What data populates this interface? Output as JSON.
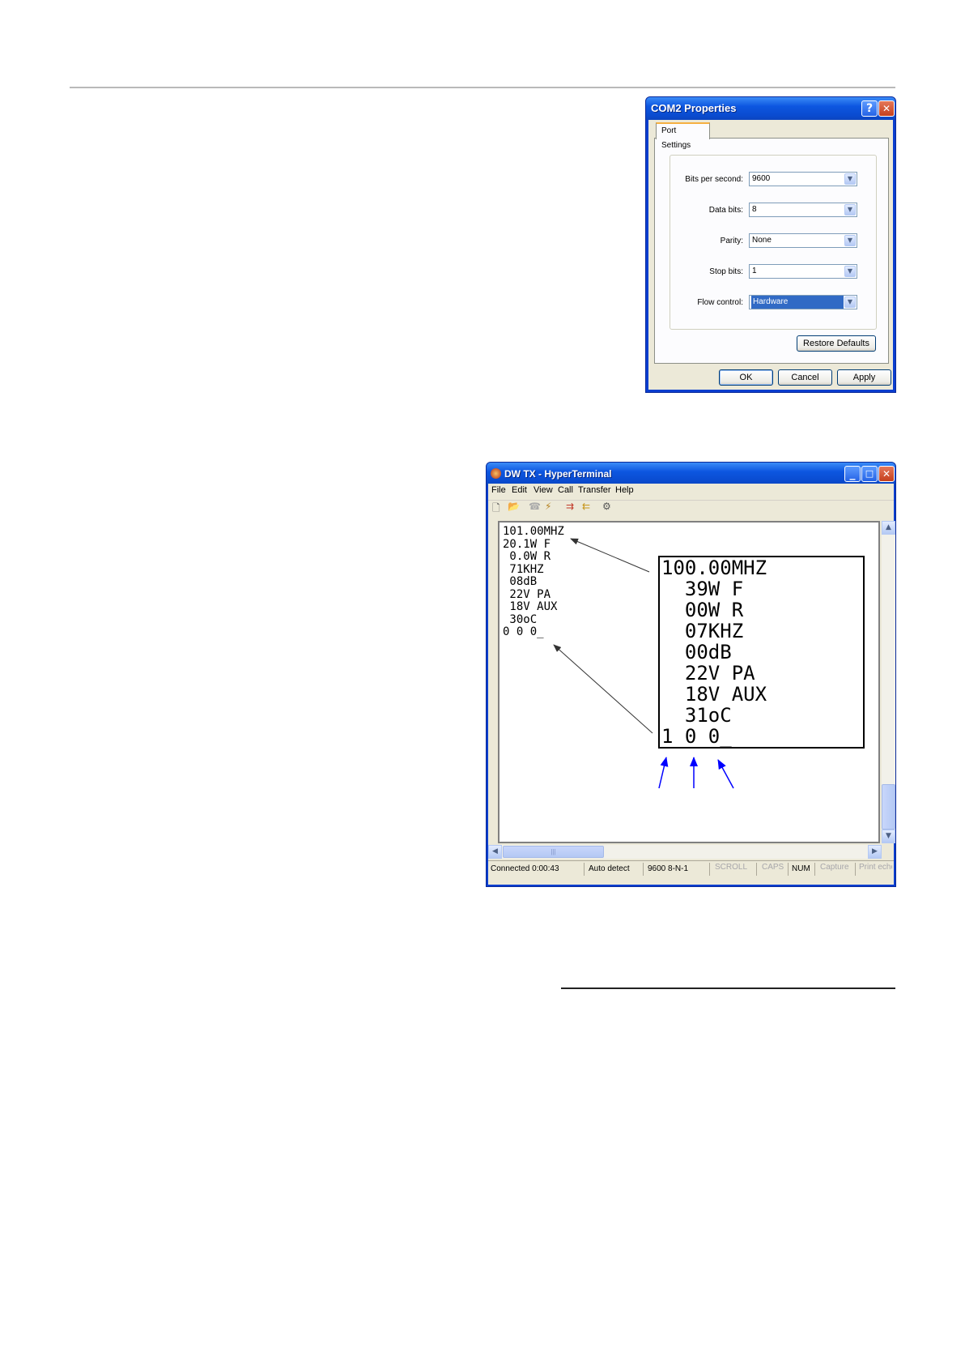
{
  "com_dialog": {
    "title": "COM2 Properties",
    "help_button": "?",
    "close_button": "✕",
    "tab": "Port Settings",
    "fields": [
      {
        "label": "Bits per second:",
        "value": "9600"
      },
      {
        "label": "Data bits:",
        "value": "8"
      },
      {
        "label": "Parity:",
        "value": "None"
      },
      {
        "label": "Stop bits:",
        "value": "1"
      },
      {
        "label": "Flow control:",
        "value": "Hardware"
      }
    ],
    "restore_defaults": "Restore Defaults",
    "ok": "OK",
    "cancel": "Cancel",
    "apply": "Apply"
  },
  "hyperterminal": {
    "title": "DW TX - HyperTerminal",
    "menu": [
      "File",
      "Edit",
      "View",
      "Call",
      "Transfer",
      "Help"
    ],
    "terminal_lines": [
      "101.00MHZ",
      "20.1W F",
      " 0.0W R",
      " 71KHZ",
      " 08dB",
      " 22V PA",
      " 18V AUX",
      " 30oC",
      "0 0 0_"
    ],
    "zoom_lines": [
      "100.00MHZ",
      "  39W F",
      "  00W R",
      "  07KHZ",
      "  00dB",
      "  22V PA",
      "  18V AUX",
      "  31oC",
      "1 0 0_"
    ],
    "status": {
      "connected": "Connected 0:00:43",
      "detect": "Auto detect",
      "settings": "9600 8-N-1",
      "scroll": "SCROLL",
      "caps": "CAPS",
      "num": "NUM",
      "capture": "Capture",
      "print": "Print echo"
    },
    "scroll_thumb_grip": "|||"
  },
  "colors": {
    "annotation_arrow": "#0000ff",
    "callout_arrow": "#333333",
    "xp_title": "#0a4bd0"
  }
}
